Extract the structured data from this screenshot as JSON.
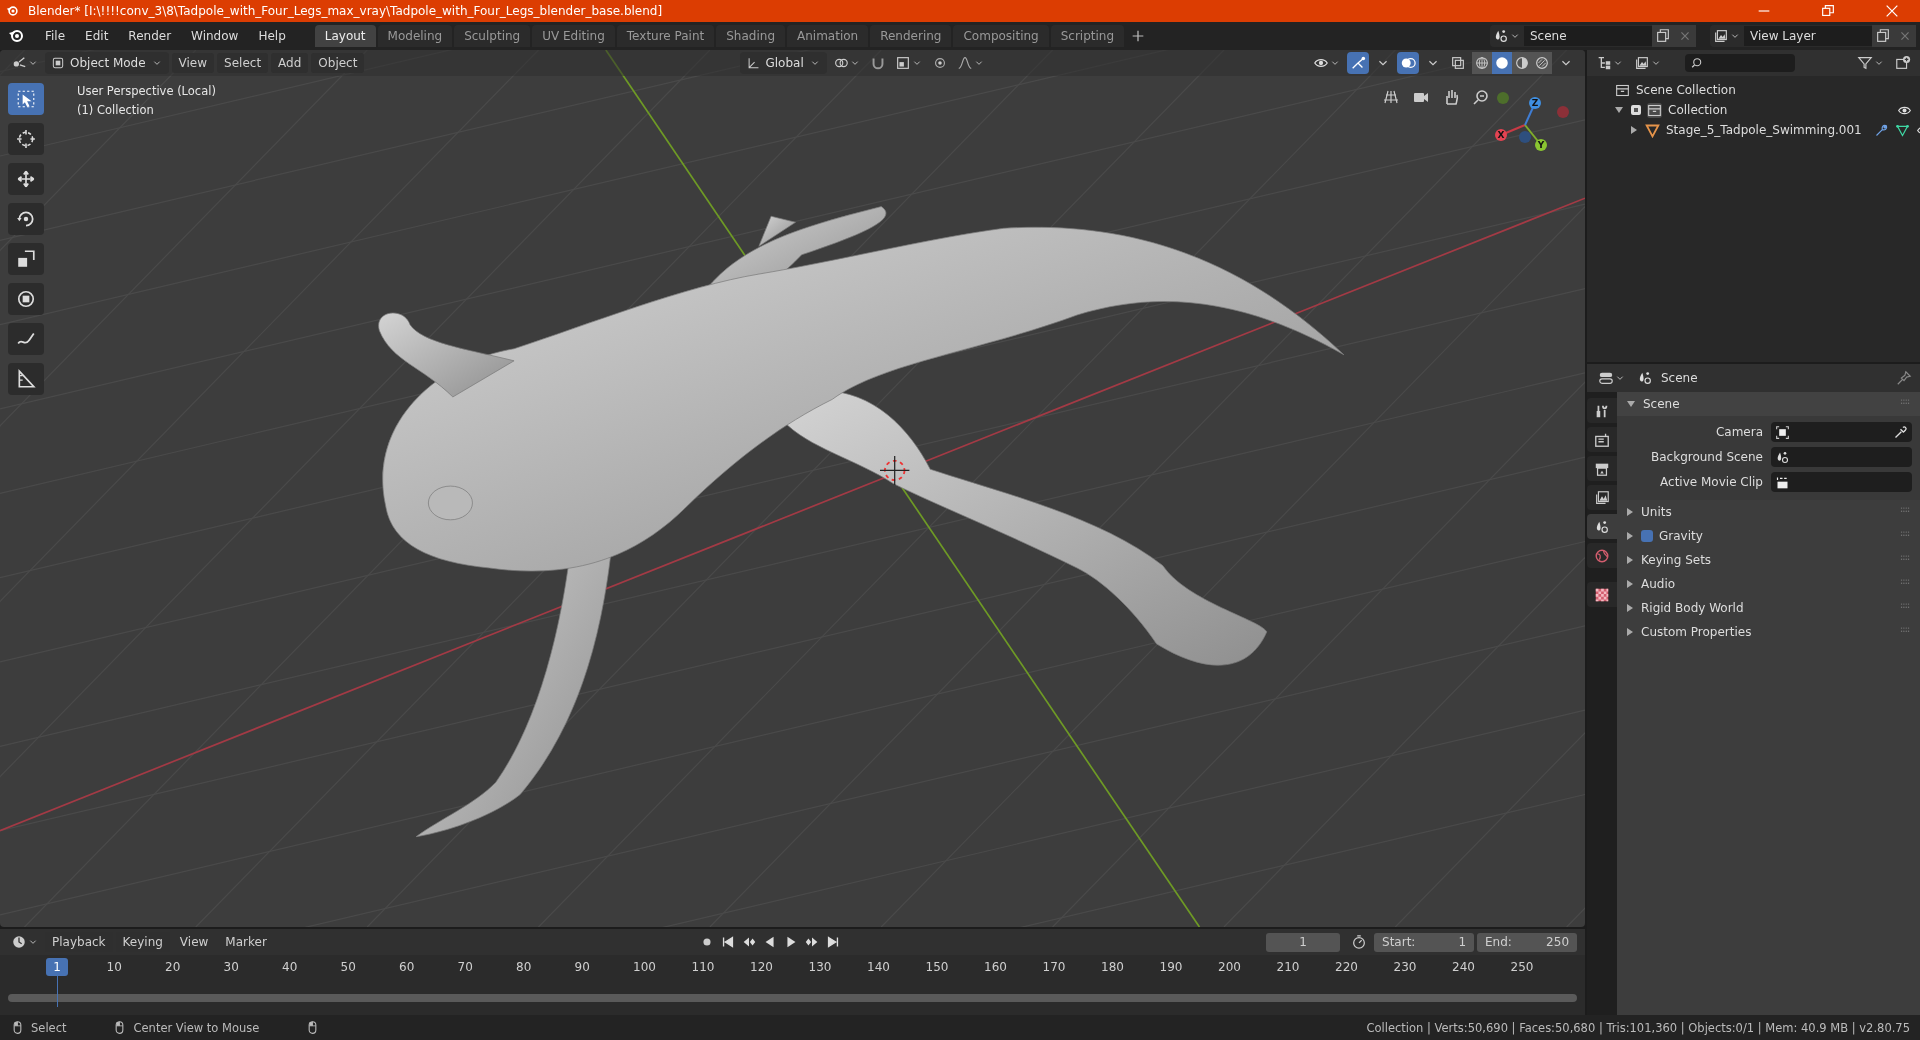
{
  "window": {
    "title": "Blender* [I:\\!!!!conv_3\\8\\Tadpole_with_Four_Legs_max_vray\\Tadpole_with_Four_Legs_blender_base.blend]"
  },
  "menu": [
    "File",
    "Edit",
    "Render",
    "Window",
    "Help"
  ],
  "workspaces": [
    {
      "label": "Layout",
      "selected": true
    },
    {
      "label": "Modeling",
      "selected": false
    },
    {
      "label": "Sculpting",
      "selected": false
    },
    {
      "label": "UV Editing",
      "selected": false
    },
    {
      "label": "Texture Paint",
      "selected": false
    },
    {
      "label": "Shading",
      "selected": false
    },
    {
      "label": "Animation",
      "selected": false
    },
    {
      "label": "Rendering",
      "selected": false
    },
    {
      "label": "Compositing",
      "selected": false
    },
    {
      "label": "Scripting",
      "selected": false
    }
  ],
  "scene_field": "Scene",
  "view_layer_field": "View Layer",
  "viewport_header": {
    "mode": "Object Mode",
    "menus": [
      "View",
      "Select",
      "Add",
      "Object"
    ],
    "orientation": "Global",
    "shading": [
      {
        "kind": "wireframe",
        "selected": false
      },
      {
        "kind": "solid",
        "selected": true
      },
      {
        "kind": "material",
        "selected": false
      },
      {
        "kind": "rendered",
        "selected": false
      }
    ]
  },
  "viewport": {
    "overlay_text": [
      "User Perspective (Local)",
      "(1) Collection"
    ],
    "gizmo_axes": [
      "Z",
      "X",
      "Y"
    ]
  },
  "tools": [
    {
      "kind": "select",
      "selected": true
    },
    {
      "kind": "cursor",
      "selected": false
    },
    {
      "kind": "move",
      "selected": false
    },
    {
      "kind": "rotate",
      "selected": false
    },
    {
      "kind": "scale",
      "selected": false
    },
    {
      "kind": "transform",
      "selected": false
    },
    {
      "kind": "annotate",
      "selected": false
    },
    {
      "kind": "measure",
      "selected": false
    }
  ],
  "outliner": {
    "root": "Scene Collection",
    "tree": [
      {
        "label": "Collection",
        "expanded": true,
        "checked": true,
        "children": [
          {
            "label": "Stage_5_Tadpole_Swimming.001",
            "expanded": false
          }
        ]
      }
    ]
  },
  "properties": {
    "header": "Scene",
    "tabs": [
      {
        "kind": "tool",
        "selected": false
      },
      {
        "kind": "render",
        "selected": false
      },
      {
        "kind": "output",
        "selected": false
      },
      {
        "kind": "view-layer",
        "selected": false
      },
      {
        "kind": "scene",
        "selected": true
      },
      {
        "kind": "world",
        "selected": false
      },
      {
        "kind": "texture",
        "selected": false
      }
    ],
    "panel": {
      "title": "Scene",
      "expanded": true,
      "fields": [
        {
          "label": "Camera",
          "kind": "camera"
        },
        {
          "label": "Background Scene",
          "kind": "scene"
        },
        {
          "label": "Active Movie Clip",
          "kind": "clip"
        }
      ]
    },
    "subpanels": [
      {
        "title": "Units",
        "expanded": false,
        "kind": "plain"
      },
      {
        "title": "Gravity",
        "expanded": false,
        "kind": "checkbox",
        "checked": true
      },
      {
        "title": "Keying Sets",
        "expanded": false,
        "kind": "plain"
      },
      {
        "title": "Audio",
        "expanded": false,
        "kind": "plain"
      },
      {
        "title": "Rigid Body World",
        "expanded": false,
        "kind": "plain"
      },
      {
        "title": "Custom Properties",
        "expanded": false,
        "kind": "plain"
      }
    ]
  },
  "timeline": {
    "menus": [
      "Playback",
      "Keying",
      "View",
      "Marker"
    ],
    "current_frame": "1",
    "start_label": "Start:",
    "start": "1",
    "end_label": "End:",
    "end": "250",
    "playhead": "1",
    "frame_labels": [
      "10",
      "20",
      "30",
      "40",
      "50",
      "60",
      "70",
      "80",
      "90",
      "100",
      "110",
      "120",
      "130",
      "140",
      "150",
      "160",
      "170",
      "180",
      "190",
      "200",
      "210",
      "220",
      "230",
      "240",
      "250"
    ]
  },
  "status_bar": {
    "hints": [
      "Select",
      "Center View to Mouse"
    ],
    "stats": "Collection | Verts:50,690 | Faces:50,680 | Tris:101,360 | Objects:0/1 | Mem: 40.9 MB | v2.80.75"
  }
}
